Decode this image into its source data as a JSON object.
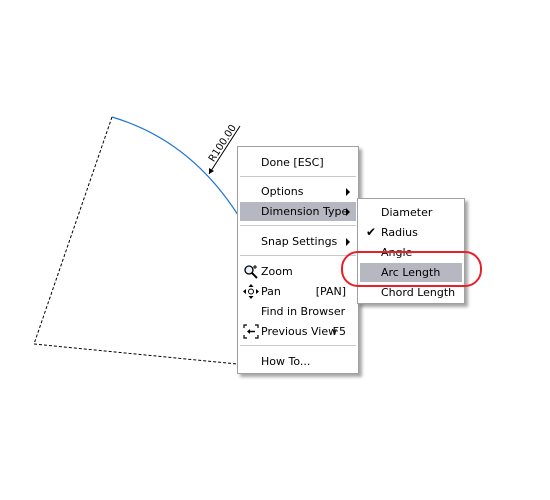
{
  "drawing": {
    "dimension_text": "R100.00"
  },
  "main_menu": {
    "items": [
      {
        "label": "Done [ESC]"
      },
      {
        "label": "Options"
      },
      {
        "label": "Dimension Type"
      },
      {
        "label": "Snap Settings"
      },
      {
        "label": "Zoom",
        "icon": "zoom-icon"
      },
      {
        "label": "Pan",
        "shortcut": "[PAN]",
        "icon": "pan-icon"
      },
      {
        "label": "Find in Browser"
      },
      {
        "label": "Previous View",
        "shortcut": "F5",
        "icon": "previous-view-icon"
      },
      {
        "label": "How To..."
      }
    ],
    "highlighted": "Dimension Type"
  },
  "sub_menu": {
    "items": [
      {
        "label": "Diameter"
      },
      {
        "label": "Radius",
        "checked": true
      },
      {
        "label": "Angle"
      },
      {
        "label": "Arc Length"
      },
      {
        "label": "Chord Length"
      }
    ],
    "highlighted": "Arc Length"
  },
  "colors": {
    "arc": "#1e74d8",
    "highlight": "#b5b8c0",
    "callout_ring": "#e8202a"
  }
}
